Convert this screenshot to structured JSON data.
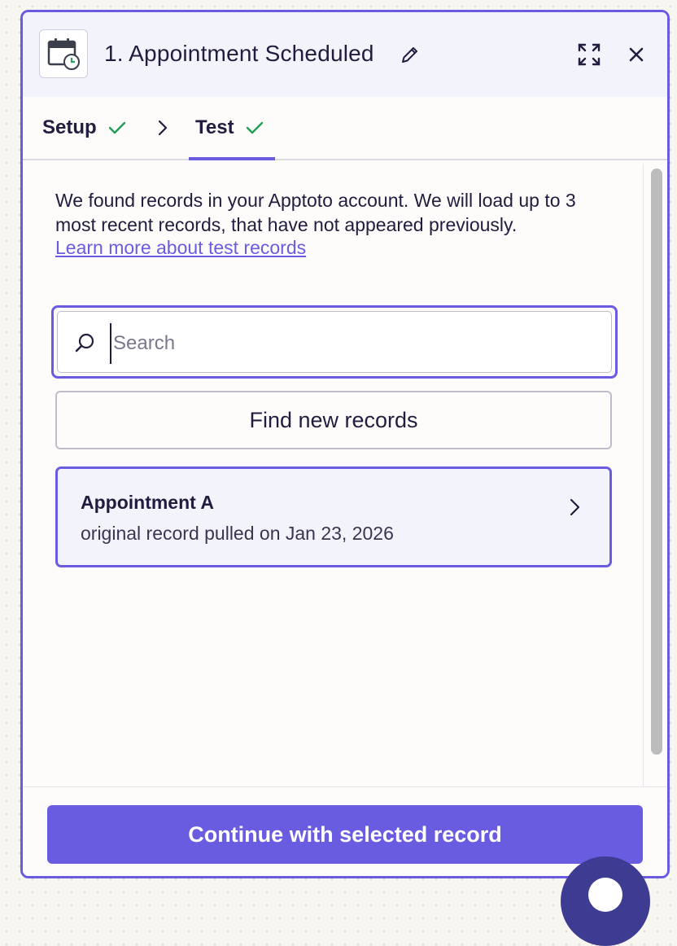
{
  "header": {
    "title": "1. Appointment Scheduled"
  },
  "tabs": [
    {
      "label": "Setup",
      "status": "complete"
    },
    {
      "label": "Test",
      "status": "complete",
      "active": true
    }
  ],
  "content": {
    "intro": "We found records in your Apptoto account. We will load up to 3 most recent records, that have not appeared previously.",
    "learn_link": "Learn more about test records"
  },
  "search": {
    "placeholder": "Search",
    "value": ""
  },
  "find_button": "Find new records",
  "records": [
    {
      "title": "Appointment A",
      "subtitle": "original record pulled on Jan 23, 2026",
      "selected": true
    }
  ],
  "footer": {
    "continue_label": "Continue with selected record"
  },
  "colors": {
    "accent": "#6a5ce0",
    "check": "#1f9d55",
    "text": "#221c3e"
  },
  "icons": [
    "calendar-clock-icon",
    "pencil-icon",
    "expand-icon",
    "close-icon",
    "check-icon",
    "chevron-right-icon",
    "search-icon"
  ]
}
